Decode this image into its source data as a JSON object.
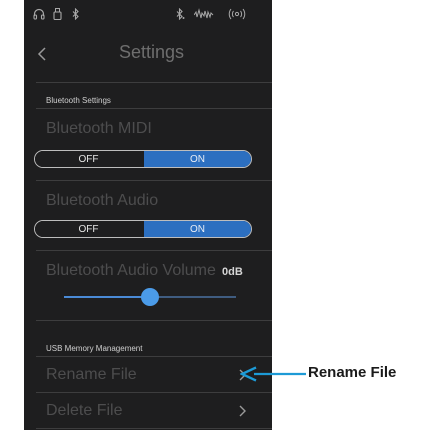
{
  "status_bar": {
    "icons": [
      "headphones-icon",
      "usb-icon",
      "bluetooth-icon",
      "bluetooth-audio-icon",
      "waveform-icon",
      "wireless-icon"
    ]
  },
  "nav": {
    "back_icon": "chevron-left-icon",
    "title": "Settings"
  },
  "bluetooth": {
    "section_title": "Bluetooth Settings",
    "midi": {
      "label": "Bluetooth MIDI",
      "off_label": "OFF",
      "on_label": "ON",
      "selected": "ON"
    },
    "audio": {
      "label": "Bluetooth Audio",
      "off_label": "OFF",
      "on_label": "ON",
      "selected": "ON"
    },
    "volume": {
      "label": "Bluetooth Audio Volume",
      "value": "0dB",
      "level": 0.5
    }
  },
  "usb": {
    "section_title": "USB Memory Management",
    "rename": {
      "label": "Rename File",
      "icon": "chevron-right-icon"
    },
    "delete": {
      "label": "Delete File",
      "icon": "chevron-right-icon"
    }
  },
  "callout": {
    "label": "Rename File"
  },
  "colors": {
    "background": "#1e1e1f",
    "accent": "#2c6fc0",
    "slider_thumb": "#4b9be8",
    "callout_arrow": "#1d9ad6"
  }
}
